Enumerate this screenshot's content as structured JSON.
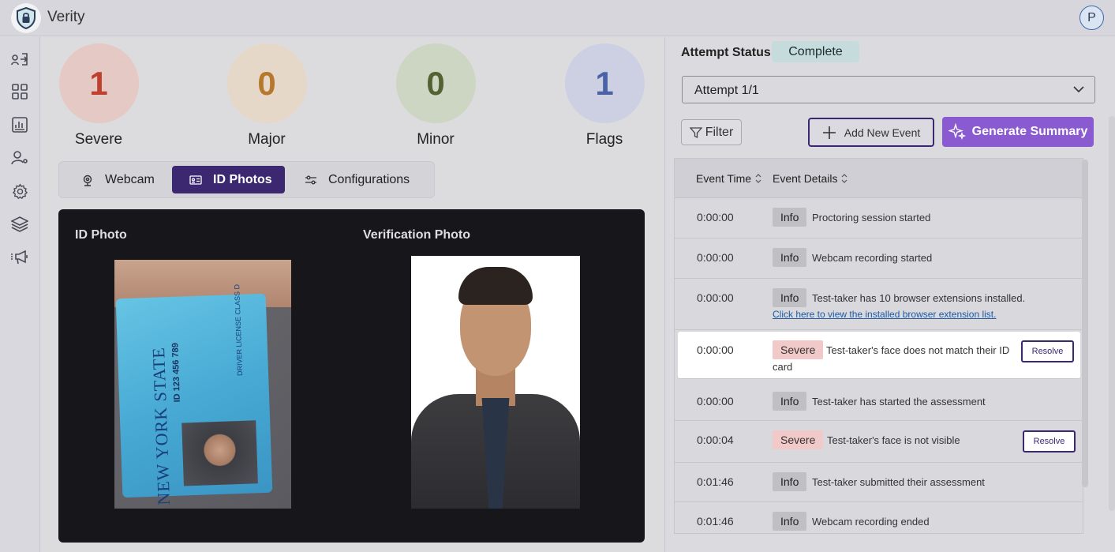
{
  "app": {
    "title": "Verity",
    "user_initial": "P"
  },
  "sidebar": [
    {
      "icon": "login-icon"
    },
    {
      "icon": "grid-icon"
    },
    {
      "icon": "report-icon"
    },
    {
      "icon": "user-settings-icon"
    },
    {
      "icon": "gear-icon"
    },
    {
      "icon": "layers-icon"
    },
    {
      "icon": "megaphone-icon"
    }
  ],
  "stats": [
    {
      "label": "Severe",
      "value": "1",
      "color": "#c0402f",
      "bg": "#e4c9c4"
    },
    {
      "label": "Major",
      "value": "0",
      "color": "#b6782d",
      "bg": "#e6d8c8"
    },
    {
      "label": "Minor",
      "value": "0",
      "color": "#536133",
      "bg": "#cdd6c3"
    },
    {
      "label": "Flags",
      "value": "1",
      "color": "#4b63a6",
      "bg": "#ccd0e2"
    }
  ],
  "tabs": [
    {
      "label": "Webcam",
      "icon": "webcam-icon",
      "active": false
    },
    {
      "label": "ID Photos",
      "icon": "id-card-icon",
      "active": true
    },
    {
      "label": "Configurations",
      "icon": "sliders-icon",
      "active": false
    }
  ],
  "photos": {
    "id_title": "ID Photo",
    "verification_title": "Verification Photo",
    "card_state": "NEW YORK STATE",
    "card_type": "DRIVER LICENSE  CLASS D",
    "card_number": "ID 123 456 789"
  },
  "attempt": {
    "status_label": "Attempt Status:",
    "status_value": "Complete",
    "selected": "Attempt 1/1"
  },
  "actions": {
    "filter": "Filter",
    "add_event": "Add New Event",
    "generate_summary": "Generate Summary"
  },
  "events": {
    "columns": [
      "Event Time",
      "Event Details"
    ],
    "resolve_label": "Resolve",
    "rows": [
      {
        "time": "0:00:00",
        "type": "Info",
        "text": "Proctoring session started"
      },
      {
        "time": "0:00:00",
        "type": "Info",
        "text": "Webcam recording started"
      },
      {
        "time": "0:00:00",
        "type": "Info",
        "text": "Test-taker has 10 browser extensions installed.",
        "link": "Click here to view the installed browser extension list."
      },
      {
        "time": "0:00:00",
        "type": "Severe",
        "text": "Test-taker's face does not match their ID",
        "text2": "card",
        "resolve": true
      },
      {
        "time": "0:00:00",
        "type": "Info",
        "text": "Test-taker has started the assessment"
      },
      {
        "time": "0:00:04",
        "type": "Severe",
        "text": "Test-taker's face is not visible",
        "resolve": true
      },
      {
        "time": "0:01:46",
        "type": "Info",
        "text": "Test-taker submitted their assessment"
      },
      {
        "time": "0:01:46",
        "type": "Info",
        "text": "Webcam recording ended"
      }
    ]
  }
}
